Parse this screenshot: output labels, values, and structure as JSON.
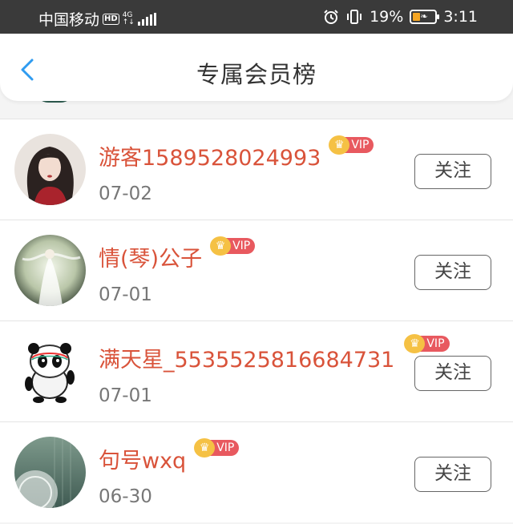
{
  "statusbar": {
    "carrier": "中国移动",
    "hd": "HD",
    "net_top": "4G",
    "net_bottom": "↑↓",
    "battery_pct": "19%",
    "time": "3:11"
  },
  "header": {
    "title": "专属会员榜"
  },
  "members": [
    {
      "name": "游客1589528024993",
      "vip_label": "VIP",
      "date": "07-02",
      "follow_label": "关注"
    },
    {
      "name": "情(琴)公子",
      "vip_label": "VIP",
      "date": "07-01",
      "follow_label": "关注"
    },
    {
      "name": "满天星_5535525816684731",
      "vip_label": "VIP",
      "date": "07-01",
      "follow_label": "关注"
    },
    {
      "name": "句号wxq",
      "vip_label": "VIP",
      "date": "06-30",
      "follow_label": "关注"
    }
  ],
  "colors": {
    "name": "#d9533a",
    "back_arrow": "#2f9bf0",
    "vip_crown": "#f5c144",
    "vip_tag": "#e8595f",
    "statusbar_bg": "#3a3a3a"
  },
  "icons": {
    "back": "chevron-left-icon",
    "alarm": "alarm-icon",
    "vibrate": "vibrate-icon",
    "battery": "battery-saver-icon",
    "signal": "signal-icon",
    "crown": "crown-icon"
  }
}
